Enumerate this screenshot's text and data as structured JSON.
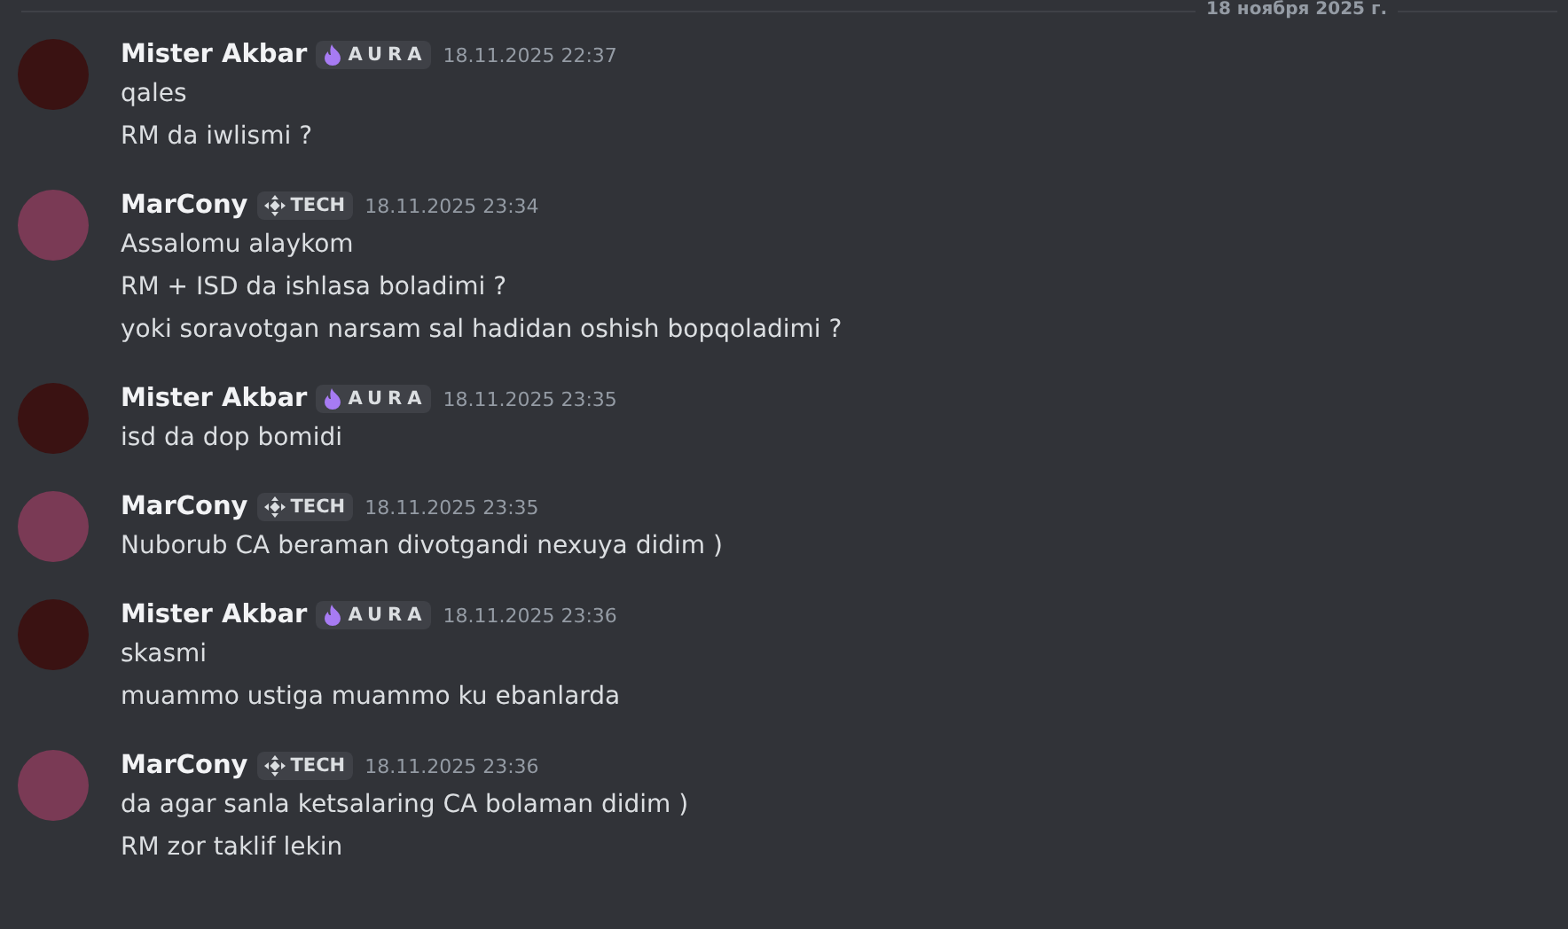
{
  "date_divider": "18 ноября 2025 г.",
  "messages": [
    {
      "author": "Mister Akbar",
      "tag": {
        "kind": "aura",
        "label": "AURA"
      },
      "timestamp": "18.11.2025 22:37",
      "lines": [
        "qales",
        "RM da iwlismi ?"
      ]
    },
    {
      "author": "MarCony",
      "tag": {
        "kind": "tech",
        "label": "TECH"
      },
      "timestamp": "18.11.2025 23:34",
      "lines": [
        "Assalomu alaykom",
        "RM + ISD da ishlasa boladimi ?",
        "yoki soravotgan narsam sal hadidan oshish bopqoladimi ?"
      ]
    },
    {
      "author": "Mister Akbar",
      "tag": {
        "kind": "aura",
        "label": "AURA"
      },
      "timestamp": "18.11.2025 23:35",
      "lines": [
        "isd da dop bomidi"
      ]
    },
    {
      "author": "MarCony",
      "tag": {
        "kind": "tech",
        "label": "TECH"
      },
      "timestamp": "18.11.2025 23:35",
      "lines": [
        "Nuborub CA beraman divotgandi nexuya didim )"
      ]
    },
    {
      "author": "Mister Akbar",
      "tag": {
        "kind": "aura",
        "label": "AURA"
      },
      "timestamp": "18.11.2025 23:36",
      "lines": [
        "skasmi",
        "muammo ustiga muammo ku ebanlarda"
      ]
    },
    {
      "author": "MarCony",
      "tag": {
        "kind": "tech",
        "label": "TECH"
      },
      "timestamp": "18.11.2025 23:36",
      "lines": [
        "da agar sanla ketsalaring CA bolaman didim )",
        "RM zor taklif lekin"
      ]
    }
  ]
}
